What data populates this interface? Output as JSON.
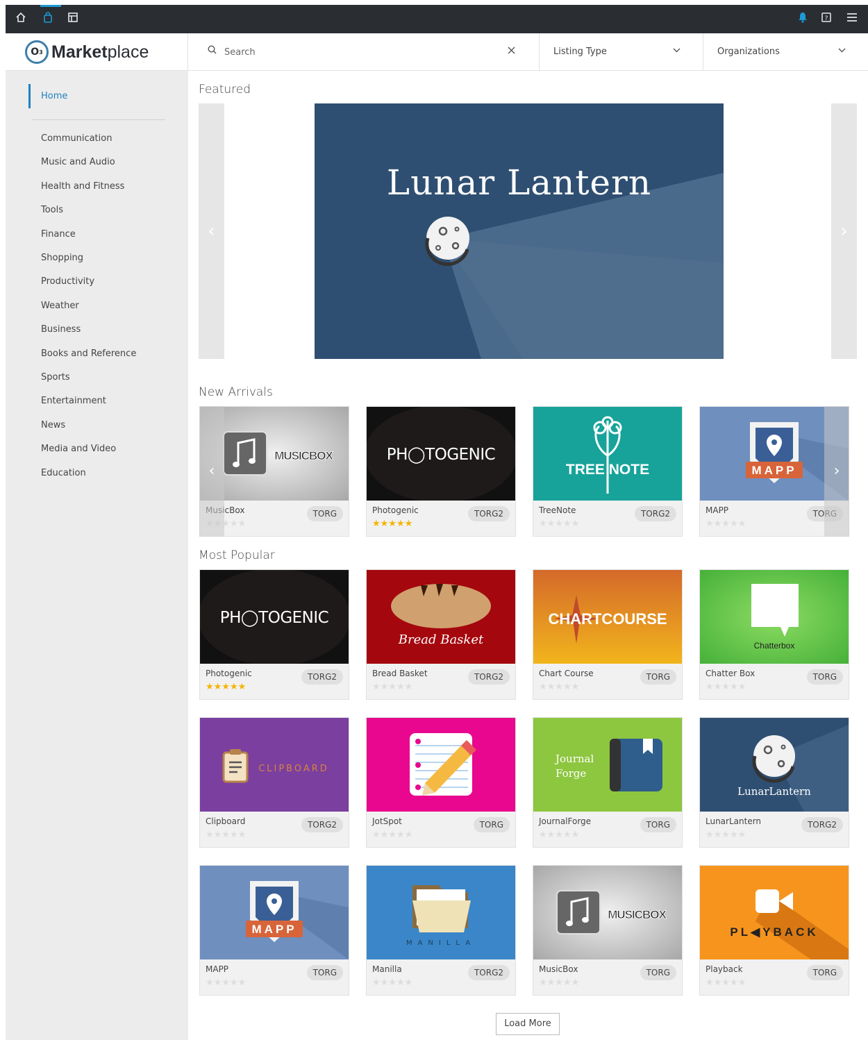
{
  "topbar": {
    "icons": [
      "home-icon",
      "bag-icon",
      "layout-icon",
      "bell-icon",
      "help-icon",
      "menu-icon"
    ],
    "accent": "#1e9ad6",
    "bg": "#2a2e33"
  },
  "header": {
    "logo_mark": "O",
    "logo_sub": "3",
    "logo_bold": "Market",
    "logo_rest": "place",
    "search_placeholder": "Search",
    "listing_type": "Listing Type",
    "organizations": "Organizations"
  },
  "sidebar": {
    "home": "Home",
    "items": [
      "Communication",
      "Music and Audio",
      "Health and Fitness",
      "Tools",
      "Finance",
      "Shopping",
      "Productivity",
      "Weather",
      "Business",
      "Books and Reference",
      "Sports",
      "Entertainment",
      "News",
      "Media and Video",
      "Education"
    ]
  },
  "sections": {
    "featured": "Featured",
    "new_arrivals": "New Arrivals",
    "most_popular": "Most Popular"
  },
  "featured": {
    "title": "Lunar Lantern"
  },
  "new_arrivals": [
    {
      "name": "MusicBox",
      "org": "TORG",
      "rating": 0,
      "art": "MUSICBOX"
    },
    {
      "name": "Photogenic",
      "org": "TORG2",
      "rating": 5,
      "art": "PHOTOGENIC"
    },
    {
      "name": "TreeNote",
      "org": "TORG2",
      "rating": 0,
      "art": "TREENOTE"
    },
    {
      "name": "MAPP",
      "org": "TORG",
      "rating": 0,
      "art": "MAPP"
    }
  ],
  "most_popular": [
    {
      "name": "Photogenic",
      "org": "TORG2",
      "rating": 5,
      "art": "PHOTOGENIC"
    },
    {
      "name": "Bread Basket",
      "org": "TORG2",
      "rating": 0,
      "art": "Bread Basket"
    },
    {
      "name": "Chart Course",
      "org": "TORG",
      "rating": 0,
      "art": "CHARTCOURSE"
    },
    {
      "name": "Chatter Box",
      "org": "TORG",
      "rating": 0,
      "art": "Chatterbox"
    },
    {
      "name": "Clipboard",
      "org": "TORG2",
      "rating": 0,
      "art": "CLIPBOARD"
    },
    {
      "name": "JotSpot",
      "org": "TORG",
      "rating": 0,
      "art": ""
    },
    {
      "name": "JournalForge",
      "org": "TORG",
      "rating": 0,
      "art": "Journal Forge"
    },
    {
      "name": "LunarLantern",
      "org": "TORG2",
      "rating": 0,
      "art": "LunarLantern"
    },
    {
      "name": "MAPP",
      "org": "TORG",
      "rating": 0,
      "art": "MAPP"
    },
    {
      "name": "Manilla",
      "org": "TORG2",
      "rating": 0,
      "art": "MANILLA"
    },
    {
      "name": "MusicBox",
      "org": "TORG",
      "rating": 0,
      "art": "MUSICBOX"
    },
    {
      "name": "Playback",
      "org": "TORG",
      "rating": 0,
      "art": "PLAYBACK"
    }
  ],
  "load_more": "Load More",
  "colors": {
    "active": "#1e82c0",
    "star_gold": "#f5b400",
    "sidebar_bg": "#ececec"
  }
}
